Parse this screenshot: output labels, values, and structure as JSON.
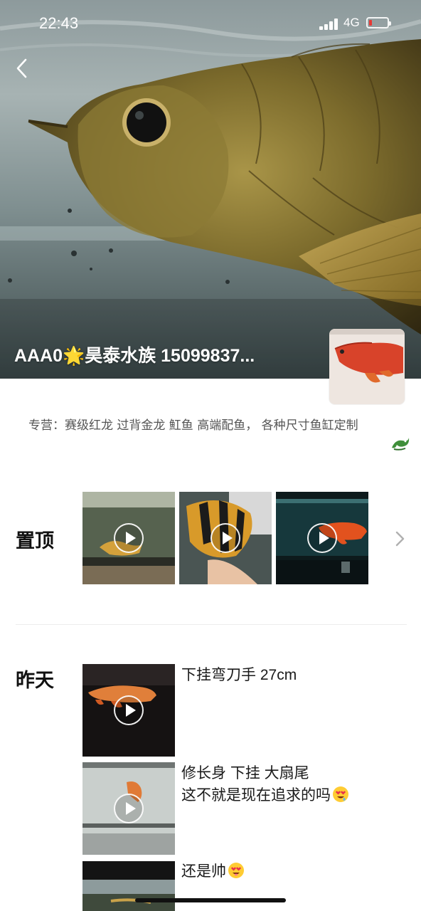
{
  "status_bar": {
    "time": "22:43",
    "network": "4G",
    "battery_level": 0.1,
    "battery_color": "#e53935"
  },
  "header": {
    "back_icon": "chevron-left-icon",
    "title": "AAA0🌟昊泰水族 15099837..."
  },
  "bio": {
    "line1": "专营：赛级红龙 过背金龙 魟鱼 高端配鱼， 各种尺寸鱼缸定制",
    "icon": "dragon-icon"
  },
  "pinned": {
    "label": "置顶",
    "items": [
      {
        "type": "video",
        "desc": "golden arowana in tank"
      },
      {
        "type": "video",
        "desc": "tiger fish held in hand"
      },
      {
        "type": "video",
        "desc": "red arowana in tank"
      }
    ],
    "more_icon": "chevron-right-icon"
  },
  "timeline": {
    "day_label": "昨天",
    "posts": [
      {
        "text": "下挂弯刀手 27cm",
        "type": "video"
      },
      {
        "text_line1": "修长身 下挂 大扇尾",
        "text_line2": "这不就是现在追求的吗",
        "emoji": "heart-eyes-drool-emoji",
        "type": "video"
      },
      {
        "text": "还是帅",
        "emoji": "heart-eyes-emoji",
        "type": "image"
      }
    ]
  },
  "colors": {
    "accent_gold": "#b8963a",
    "arowana_red": "#d8432a"
  }
}
